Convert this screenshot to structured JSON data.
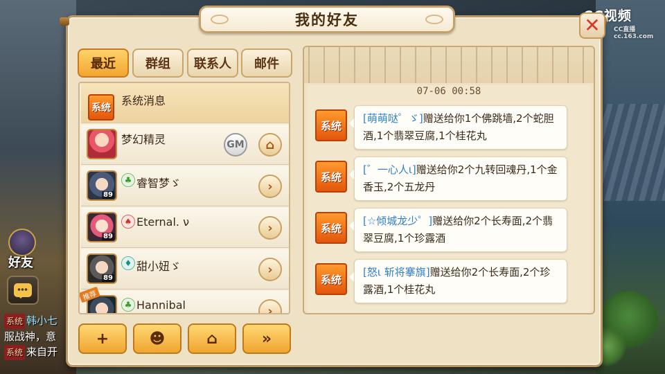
{
  "watermark": {
    "brand": "CC视频",
    "sub": "CC直播",
    "domain": "cc.163.com"
  },
  "background_ui": {
    "friends_label": "好友",
    "chat_lines": [
      {
        "tag": "系统",
        "name": "韩小七",
        "text": ""
      },
      {
        "tag": "",
        "name": "",
        "text": "服战神，意"
      },
      {
        "tag": "系统",
        "name": "",
        "text": "来自开"
      }
    ]
  },
  "dialog": {
    "title": "我的好友",
    "close_label": "✕"
  },
  "tabs": [
    {
      "label": "最近",
      "active": true
    },
    {
      "label": "群组",
      "active": false
    },
    {
      "label": "联系人",
      "active": false
    },
    {
      "label": "邮件",
      "active": false
    }
  ],
  "contacts": [
    {
      "name": "系统消息",
      "type": "system",
      "badge": "系统"
    },
    {
      "name": "梦幻精灵",
      "type": "gm",
      "gm_label": "GM",
      "action_icon": "home-icon"
    },
    {
      "name": "睿智梦ゞ",
      "type": "friend",
      "level": "89",
      "mood": "leaf"
    },
    {
      "name": "Eternal. ν",
      "type": "friend",
      "level": "89",
      "mood": "fire"
    },
    {
      "name": "甜小妞ゞ",
      "type": "friend",
      "level": "89",
      "mood": "water"
    },
    {
      "name": "Hannibal",
      "type": "friend",
      "level": "",
      "mood": "leaf",
      "tag": "推荐"
    }
  ],
  "bottom_buttons": [
    {
      "name": "add-friend",
      "icon": "add-user-icon",
      "glyph": "+"
    },
    {
      "name": "chat",
      "icon": "chat-icon",
      "glyph": "☻"
    },
    {
      "name": "home",
      "icon": "home-icon",
      "glyph": "⌂"
    },
    {
      "name": "more",
      "icon": "double-chevron-right-icon",
      "glyph": "»"
    }
  ],
  "messages": {
    "timestamp": "07-06 00:58",
    "badge": "系统",
    "items": [
      {
        "sender": "[萌萌哒゜ゞ]",
        "text": "赠送给你1个佛跳墙,2个蛇胆酒,1个翡翠豆腐,1个桂花丸"
      },
      {
        "sender": "[゛一心人ι]",
        "text": "赠送给你2个九转回魂丹,1个金香玉,2个五龙丹"
      },
      {
        "sender": "[☆倾城龙少゜]",
        "text": "赠送给你2个长寿面,2个翡翠豆腐,1个珍露酒"
      },
      {
        "sender": "[怒ι 斩将搴旗]",
        "text": "赠送给你2个长寿面,2个珍露酒,1个桂花丸"
      }
    ]
  },
  "colors": {
    "panel_bg": "#efe2c4",
    "tab_active": "#f2a531",
    "system_badge": "#e2560c",
    "sender_blue": "#2f7fc9"
  }
}
